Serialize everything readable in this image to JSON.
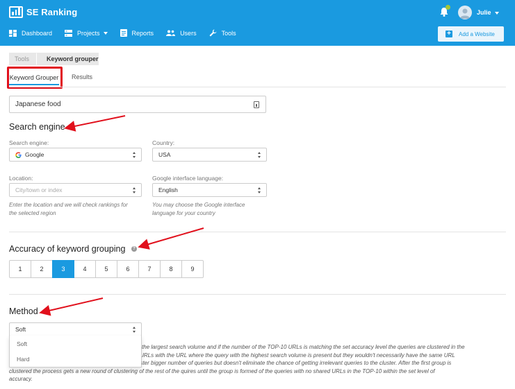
{
  "app": {
    "name": "SE Ranking",
    "username": "Julie"
  },
  "nav": {
    "dashboard": "Dashboard",
    "projects": "Projects",
    "reports": "Reports",
    "users": "Users",
    "tools": "Tools",
    "add_website": "Add a Website"
  },
  "breadcrumb": [
    "Tools",
    "Keyword grouper"
  ],
  "tabs": [
    "Keyword Grouper",
    "Results"
  ],
  "keyword_input": {
    "value": "Japanese food"
  },
  "search_engine_section": {
    "title": "Search engine",
    "engine_label": "Search engine:",
    "engine_value": "Google",
    "country_label": "Country:",
    "country_value": "USA",
    "location_label": "Location:",
    "location_placeholder": "City/town or index",
    "location_help_1": "Enter the location and we will check rankings for",
    "location_help_2": "the selected region",
    "language_label": "Google interface language:",
    "language_value": "English",
    "language_help_1": "You may choose the Google interface",
    "language_help_2": "language for your country"
  },
  "accuracy_section": {
    "title": "Accuracy of keyword grouping",
    "levels": [
      "1",
      "2",
      "3",
      "4",
      "5",
      "6",
      "7",
      "8",
      "9"
    ],
    "selected": "3"
  },
  "method_section": {
    "title": "Method",
    "selected": "Soft",
    "options": [
      "Soft",
      "Hard"
    ],
    "desc_1": "the largest search volume and if the number of the TOP-10 URLs is matching the set accuracy level the queries are clustered in the",
    "desc_2": "ed URLs with the URL where the query with the highest search volume is present but they wouldn't necessarily have the same URL",
    "desc_3": "uster bigger number of queries but doesn't eliminate the chance of getting irrelevant queries to the cluster. After the first group is",
    "desc_4": "clustered the process gets a new round of clustering of the rest of the quires until the group is formed of the queries with no shared URLs in the TOP-10 within the set level of",
    "desc_5": "accuracy."
  },
  "colors": {
    "brand": "#1a9ae0",
    "annotation": "#e1101c"
  }
}
